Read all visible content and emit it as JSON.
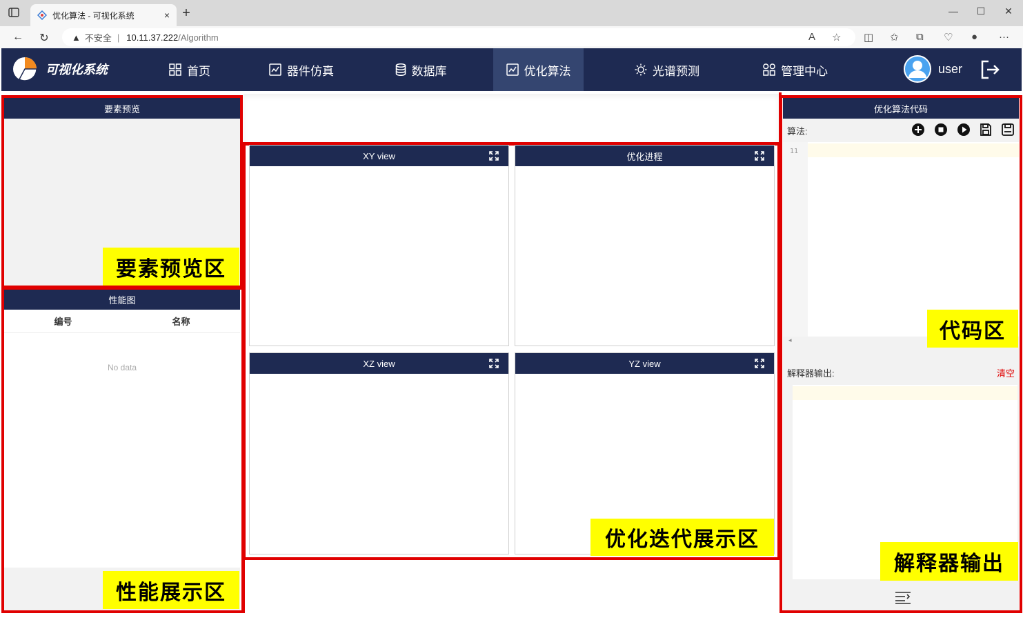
{
  "browser": {
    "tab_title": "优化算法 - 可视化系统",
    "tab_close": "×",
    "new_tab": "+",
    "insecure_label": "不安全",
    "url_host": "10.11.37.222",
    "url_path": "/Algorithm",
    "window_controls": [
      "—",
      "☐",
      "✕"
    ]
  },
  "header": {
    "brand": "可视化系统",
    "nav": [
      {
        "label": "首页",
        "icon": "grid-icon"
      },
      {
        "label": "器件仿真",
        "icon": "chart-icon"
      },
      {
        "label": "数据库",
        "icon": "database-icon"
      },
      {
        "label": "优化算法",
        "icon": "chart-icon",
        "active": true
      },
      {
        "label": "光谱预测",
        "icon": "sun-icon"
      },
      {
        "label": "管理中心",
        "icon": "grid-icon"
      }
    ],
    "user": "user"
  },
  "left": {
    "preview_title": "要素预览",
    "preview_tag": "要素预览区",
    "perf_title": "性能图",
    "col_id": "编号",
    "col_name": "名称",
    "no_data": "No data",
    "perf_tag": "性能展示区"
  },
  "center": {
    "views": [
      "XY view",
      "优化进程",
      "XZ view",
      "YZ view"
    ],
    "tag": "优化迭代展示区"
  },
  "right": {
    "title": "优化算法代码",
    "algo_label": "算法:",
    "line_number": "11",
    "code_tag": "代码区",
    "interp_label": "解释器输出:",
    "clear": "清空",
    "output_tag": "解释器输出"
  },
  "colors": {
    "header": "#1e2a52",
    "highlight": "#e00000",
    "tag_bg": "#ffff00"
  }
}
